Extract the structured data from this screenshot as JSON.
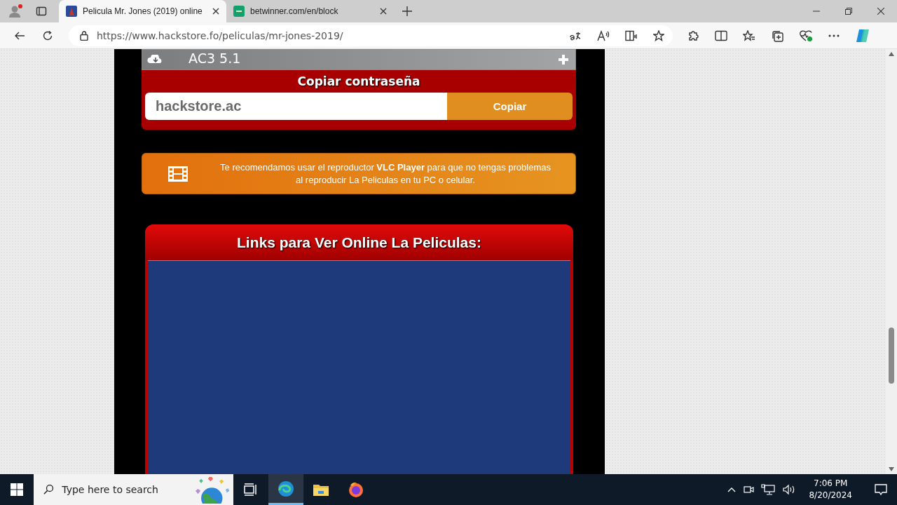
{
  "browser": {
    "tabs": [
      {
        "title": "Pelicula Mr. Jones (2019) online",
        "kind": "poster",
        "selected": true
      },
      {
        "title": "betwinner.com/en/block",
        "kind": "site",
        "selected": false
      }
    ],
    "address": "https://www.hackstore.fo/peliculas/mr-jones-2019/"
  },
  "page": {
    "download_bar": {
      "text": "AC3 5.1"
    },
    "password": {
      "title": "Copiar contraseña",
      "value": "hackstore.ac",
      "button": "Copiar"
    },
    "notice": {
      "text": "Te recomendamos usar el reproductor **VLC Player** para que no tengas problemas al reproducir La Peliculas en tu PC o celular."
    },
    "links_panel": {
      "title": "Links para Ver Online La Peliculas:"
    }
  },
  "taskbar": {
    "search_placeholder": "Type here to search",
    "apps": [
      {
        "kind": "taskview",
        "selected": false
      },
      {
        "kind": "edge",
        "selected": true
      },
      {
        "kind": "explorer",
        "selected": false
      },
      {
        "kind": "firefox",
        "selected": false
      }
    ],
    "time": "7:06 PM",
    "date": "8/20/2024"
  }
}
